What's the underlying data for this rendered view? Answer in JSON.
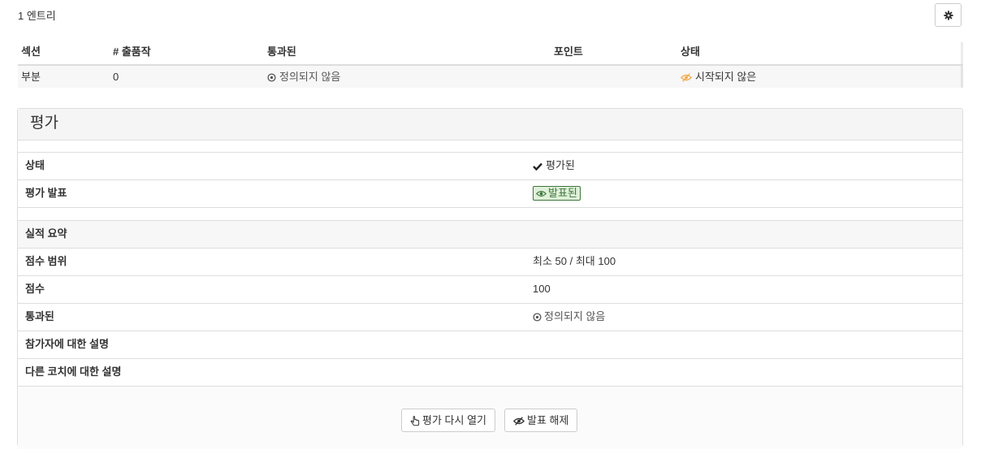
{
  "entries_count": "1 엔트리",
  "summary": {
    "headers": [
      "섹션",
      "# 출품작",
      "통과된",
      "포인트",
      "상태"
    ],
    "row": {
      "section": "부분",
      "submissions": "0",
      "passed": "정의되지 않음",
      "points": "",
      "status": "시작되지 않은"
    }
  },
  "assessment": {
    "title": "평가",
    "status_label": "상태",
    "status_value": "평가된",
    "publish_label": "평가 발표",
    "publish_value": "발표된",
    "summary_label": "실적 요약",
    "score_range_label": "점수 범위",
    "score_range_value": "최소 50 / 최대 100",
    "score_label": "점수",
    "score_value": "100",
    "passed_label": "통과된",
    "passed_value": "정의되지 않음",
    "comment_participant_label": "참가자에 대한 설명",
    "comment_coach_label": "다른 코치에 대한 설명",
    "reopen_button": "평가 다시 열기",
    "unpublish_button": "발표 해제"
  },
  "colors": {
    "badge_green": "#3c763d",
    "status_orange": "#f0ad4e",
    "border": "#dddddd"
  }
}
